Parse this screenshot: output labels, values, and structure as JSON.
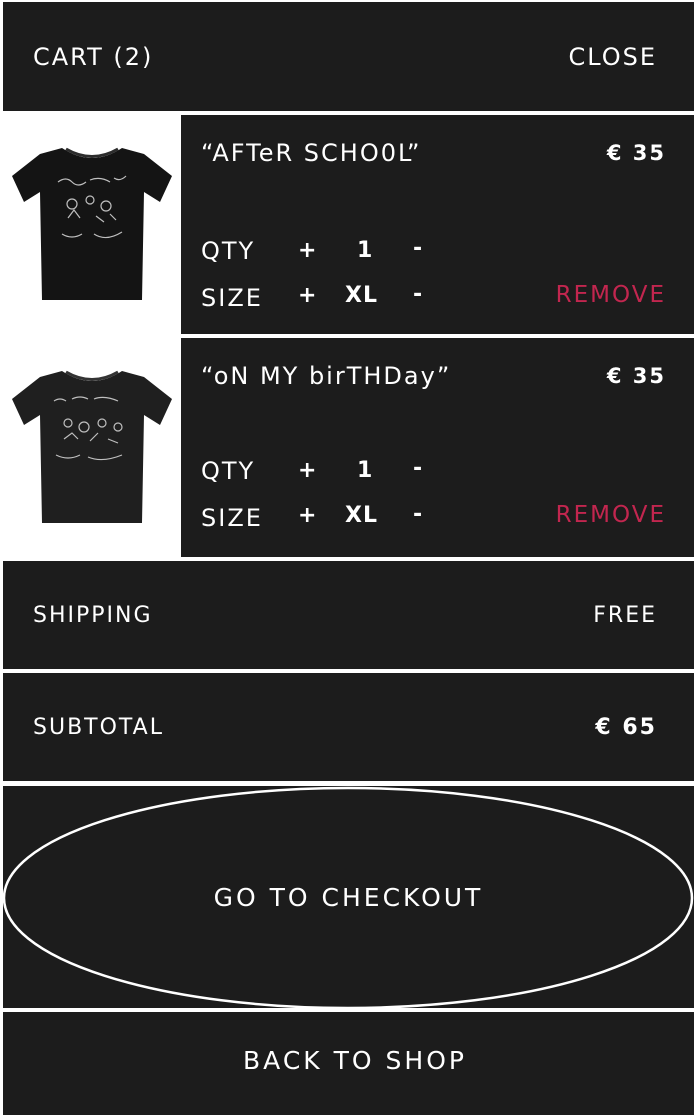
{
  "header": {
    "title": "CART (2)",
    "close_label": "CLOSE"
  },
  "items": [
    {
      "name": "“AFTeR SCHO0L”",
      "price": "€ 35",
      "qty_label": "QTY",
      "qty_value": "1",
      "size_label": "SIZE",
      "size_value": "XL",
      "plus": "+",
      "minus": "-",
      "remove_label": "REMOVE",
      "image_icon": "black-tshirt-icon"
    },
    {
      "name": "“oN MY birTHDay”",
      "price": "€ 35",
      "qty_label": "QTY",
      "qty_value": "1",
      "size_label": "SIZE",
      "size_value": "XL",
      "plus": "+",
      "minus": "-",
      "remove_label": "REMOVE",
      "image_icon": "black-tshirt-icon"
    }
  ],
  "shipping": {
    "label": "SHIPPING",
    "value": "FREE"
  },
  "subtotal": {
    "label": "SUBTOTAL",
    "value": "€ 65"
  },
  "checkout_label": "GO TO CHECKOUT",
  "back_label": "BACK TO SHOP",
  "colors": {
    "panel": "#1c1c1c",
    "background": "#ffffff",
    "remove": "#c2264f"
  }
}
